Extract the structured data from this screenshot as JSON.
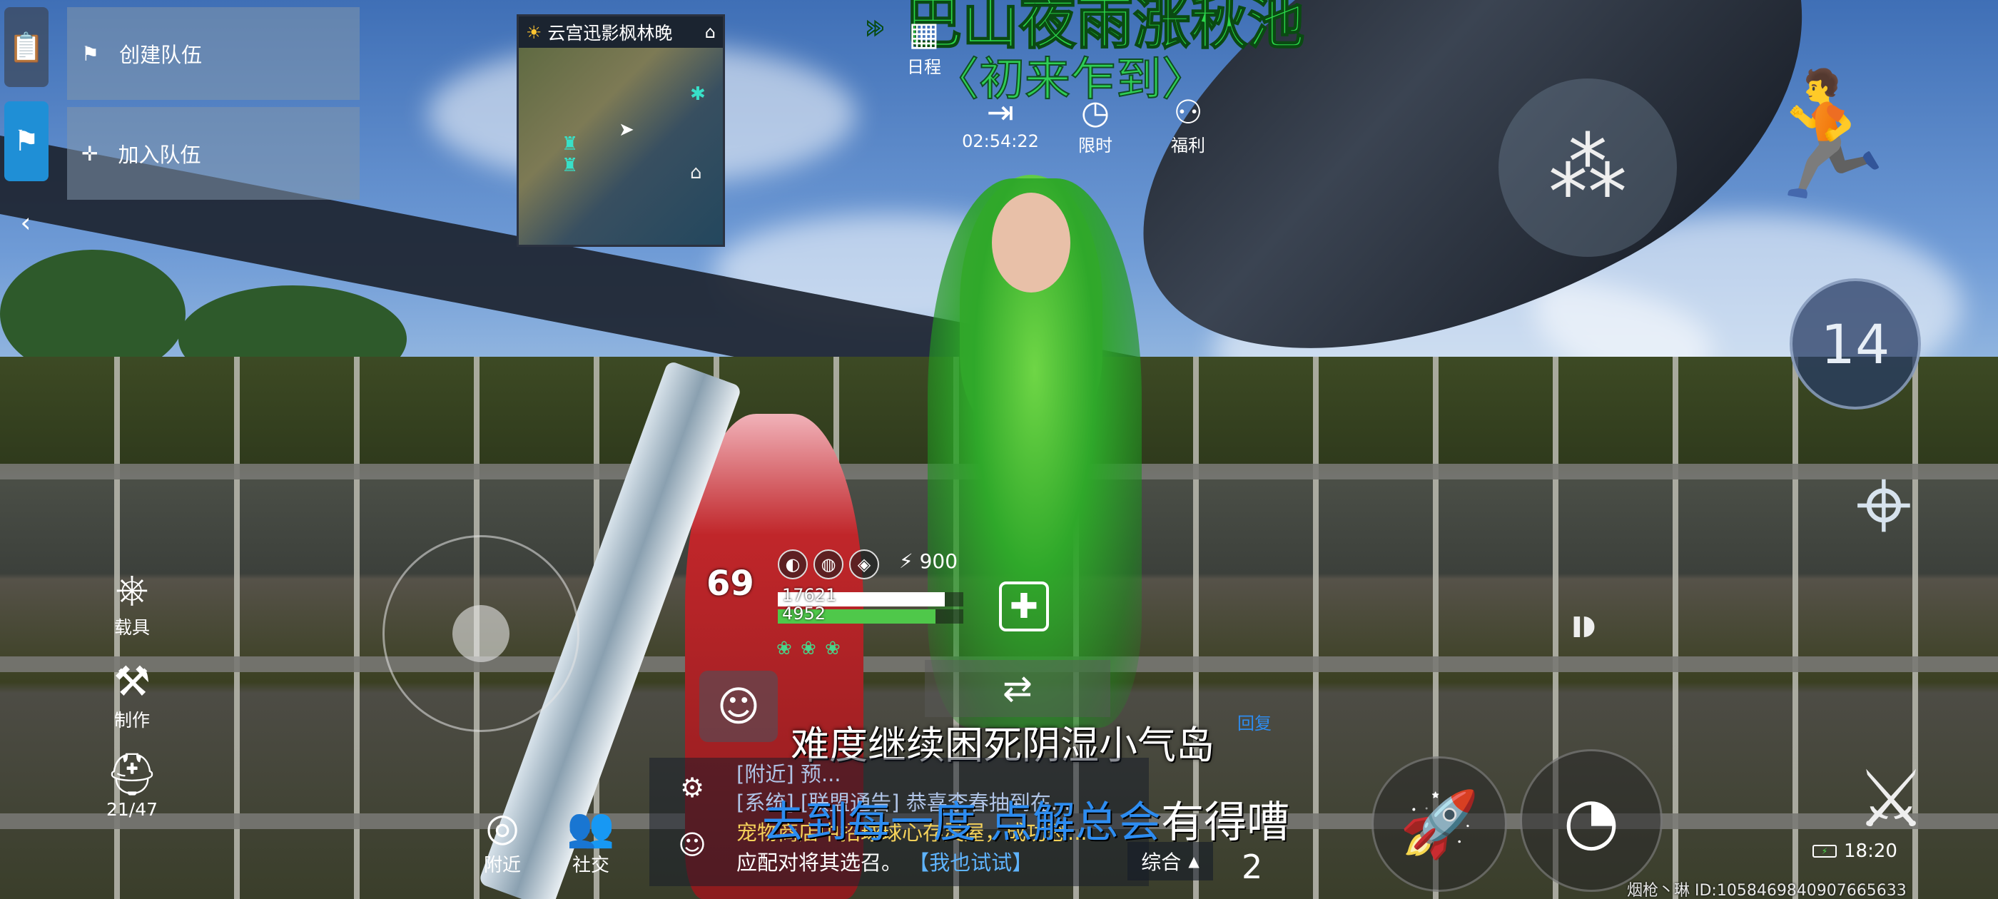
{
  "left_tabs": [
    {
      "icon": "clipboard-icon",
      "glyph": "📋"
    },
    {
      "icon": "team-flag-icon",
      "glyph": "⚑"
    }
  ],
  "team_panel": {
    "create_team": "创建队伍",
    "join_team": "加入队伍",
    "create_icon": "flag-icon",
    "join_icon": "plus-icon"
  },
  "minimap": {
    "location": "云宫迅影枫林晚",
    "weather_icon": "sun-icon",
    "locate_icon": "location-pin-icon"
  },
  "event": {
    "title": "巴山夜雨涨秋池",
    "subtitle": "〈初来乍到〉"
  },
  "top_menu": {
    "schedule": "日程",
    "timer": "02:54:22",
    "limited": "限时",
    "welfare": "福利"
  },
  "right_controls": {
    "ammo_count": "14",
    "jump_icon": "jump-icon",
    "aim_icon": "crosshair-icon",
    "fire_icon": "bullet-icon",
    "crouch_icon": "crouch-aim-icon"
  },
  "left_tools": {
    "vehicle": "载具",
    "craft": "制作",
    "backpack_count": "21/47"
  },
  "player_status": {
    "level": "69",
    "energy": "900",
    "hp_value": "17621",
    "shield_value": "4952",
    "hp_fraction": 0.9,
    "shield_fraction": 0.85,
    "hp_color": "#ffffff",
    "shield_color": "#4fc84a"
  },
  "chat": {
    "quest_text": "难度继续困死阴湿小气岛",
    "line_nearby": "[附近] 预...",
    "line_system": "[系统] [联盟通告] 恭喜李春抽到在...",
    "line_pet": "宠物商店中招球球心存灵屋，成功恐...",
    "line_prompt": "应配对将其选召。",
    "line_link": "【我也试试】",
    "overlay_blue": "去到每一度 点解总会",
    "overlay_white": "有得嘈",
    "filter": "综合",
    "reply_tag": "回复"
  },
  "bottom_bar": {
    "nearby": "附近",
    "social": "社交",
    "page": "2"
  },
  "system": {
    "clock": "18:20",
    "player_tag": "烟枪丶琳 ID:1058469840907665633"
  }
}
